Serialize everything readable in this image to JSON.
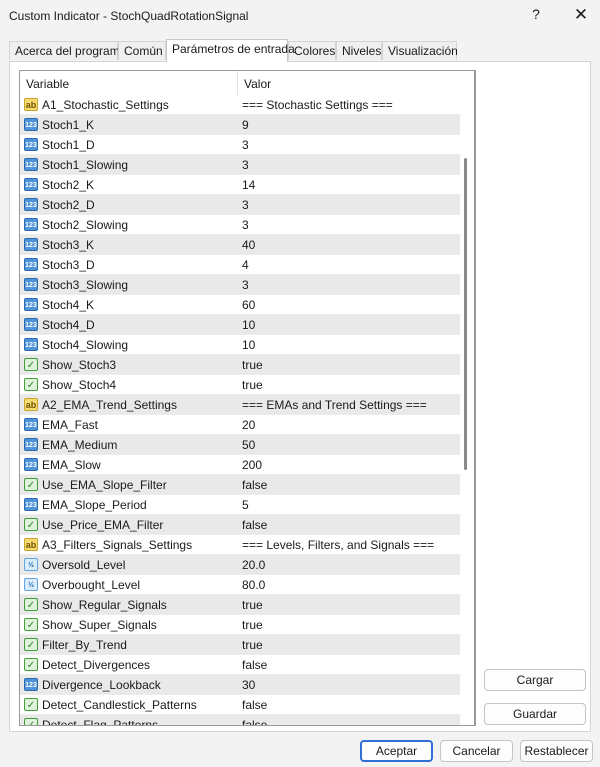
{
  "window": {
    "title": "Custom Indicator - StochQuadRotationSignal",
    "help_glyph": "?",
    "close_glyph": "✕"
  },
  "tabs": [
    {
      "label": "Acerca del programa"
    },
    {
      "label": "Común"
    },
    {
      "label": "Parámetros de entrada"
    },
    {
      "label": "Colores"
    },
    {
      "label": "Niveles"
    },
    {
      "label": "Visualización"
    }
  ],
  "grid": {
    "col_variable": "Variable",
    "col_value": "Valor",
    "rows": [
      {
        "type": "string",
        "icon_text": "ab",
        "name": "A1_Stochastic_Settings",
        "value": "=== Stochastic Settings ==="
      },
      {
        "type": "int",
        "icon_text": "123",
        "name": "Stoch1_K",
        "value": "9"
      },
      {
        "type": "int",
        "icon_text": "123",
        "name": "Stoch1_D",
        "value": "3"
      },
      {
        "type": "int",
        "icon_text": "123",
        "name": "Stoch1_Slowing",
        "value": "3"
      },
      {
        "type": "int",
        "icon_text": "123",
        "name": "Stoch2_K",
        "value": "14"
      },
      {
        "type": "int",
        "icon_text": "123",
        "name": "Stoch2_D",
        "value": "3"
      },
      {
        "type": "int",
        "icon_text": "123",
        "name": "Stoch2_Slowing",
        "value": "3"
      },
      {
        "type": "int",
        "icon_text": "123",
        "name": "Stoch3_K",
        "value": "40"
      },
      {
        "type": "int",
        "icon_text": "123",
        "name": "Stoch3_D",
        "value": "4"
      },
      {
        "type": "int",
        "icon_text": "123",
        "name": "Stoch3_Slowing",
        "value": "3"
      },
      {
        "type": "int",
        "icon_text": "123",
        "name": "Stoch4_K",
        "value": "60"
      },
      {
        "type": "int",
        "icon_text": "123",
        "name": "Stoch4_D",
        "value": "10"
      },
      {
        "type": "int",
        "icon_text": "123",
        "name": "Stoch4_Slowing",
        "value": "10"
      },
      {
        "type": "bool",
        "icon_text": "✓",
        "name": "Show_Stoch3",
        "value": "true"
      },
      {
        "type": "bool",
        "icon_text": "✓",
        "name": "Show_Stoch4",
        "value": "true"
      },
      {
        "type": "string",
        "icon_text": "ab",
        "name": "A2_EMA_Trend_Settings",
        "value": "=== EMAs and Trend Settings ==="
      },
      {
        "type": "int",
        "icon_text": "123",
        "name": "EMA_Fast",
        "value": "20"
      },
      {
        "type": "int",
        "icon_text": "123",
        "name": "EMA_Medium",
        "value": "50"
      },
      {
        "type": "int",
        "icon_text": "123",
        "name": "EMA_Slow",
        "value": "200"
      },
      {
        "type": "bool",
        "icon_text": "✓",
        "name": "Use_EMA_Slope_Filter",
        "value": "false"
      },
      {
        "type": "int",
        "icon_text": "123",
        "name": "EMA_Slope_Period",
        "value": "5"
      },
      {
        "type": "bool",
        "icon_text": "✓",
        "name": "Use_Price_EMA_Filter",
        "value": "false"
      },
      {
        "type": "string",
        "icon_text": "ab",
        "name": "A3_Filters_Signals_Settings",
        "value": "=== Levels, Filters, and Signals ==="
      },
      {
        "type": "double",
        "icon_text": "½",
        "name": "Oversold_Level",
        "value": "20.0"
      },
      {
        "type": "double",
        "icon_text": "½",
        "name": "Overbought_Level",
        "value": "80.0"
      },
      {
        "type": "bool",
        "icon_text": "✓",
        "name": "Show_Regular_Signals",
        "value": "true"
      },
      {
        "type": "bool",
        "icon_text": "✓",
        "name": "Show_Super_Signals",
        "value": "true"
      },
      {
        "type": "bool",
        "icon_text": "✓",
        "name": "Filter_By_Trend",
        "value": "true"
      },
      {
        "type": "bool",
        "icon_text": "✓",
        "name": "Detect_Divergences",
        "value": "false"
      },
      {
        "type": "int",
        "icon_text": "123",
        "name": "Divergence_Lookback",
        "value": "30"
      },
      {
        "type": "bool",
        "icon_text": "✓",
        "name": "Detect_Candlestick_Patterns",
        "value": "false"
      },
      {
        "type": "bool",
        "icon_text": "✓",
        "name": "Detect_Flag_Patterns",
        "value": "false"
      }
    ]
  },
  "side_buttons": {
    "load": "Cargar",
    "save": "Guardar"
  },
  "footer": {
    "accept": "Aceptar",
    "cancel": "Cancelar",
    "reset": "Restablecer"
  },
  "colors": {
    "accent": "#2f6fd6",
    "string_icon": "#f6dc70",
    "number_icon": "#4f94d8",
    "bool_icon": "#3f9e3a"
  }
}
